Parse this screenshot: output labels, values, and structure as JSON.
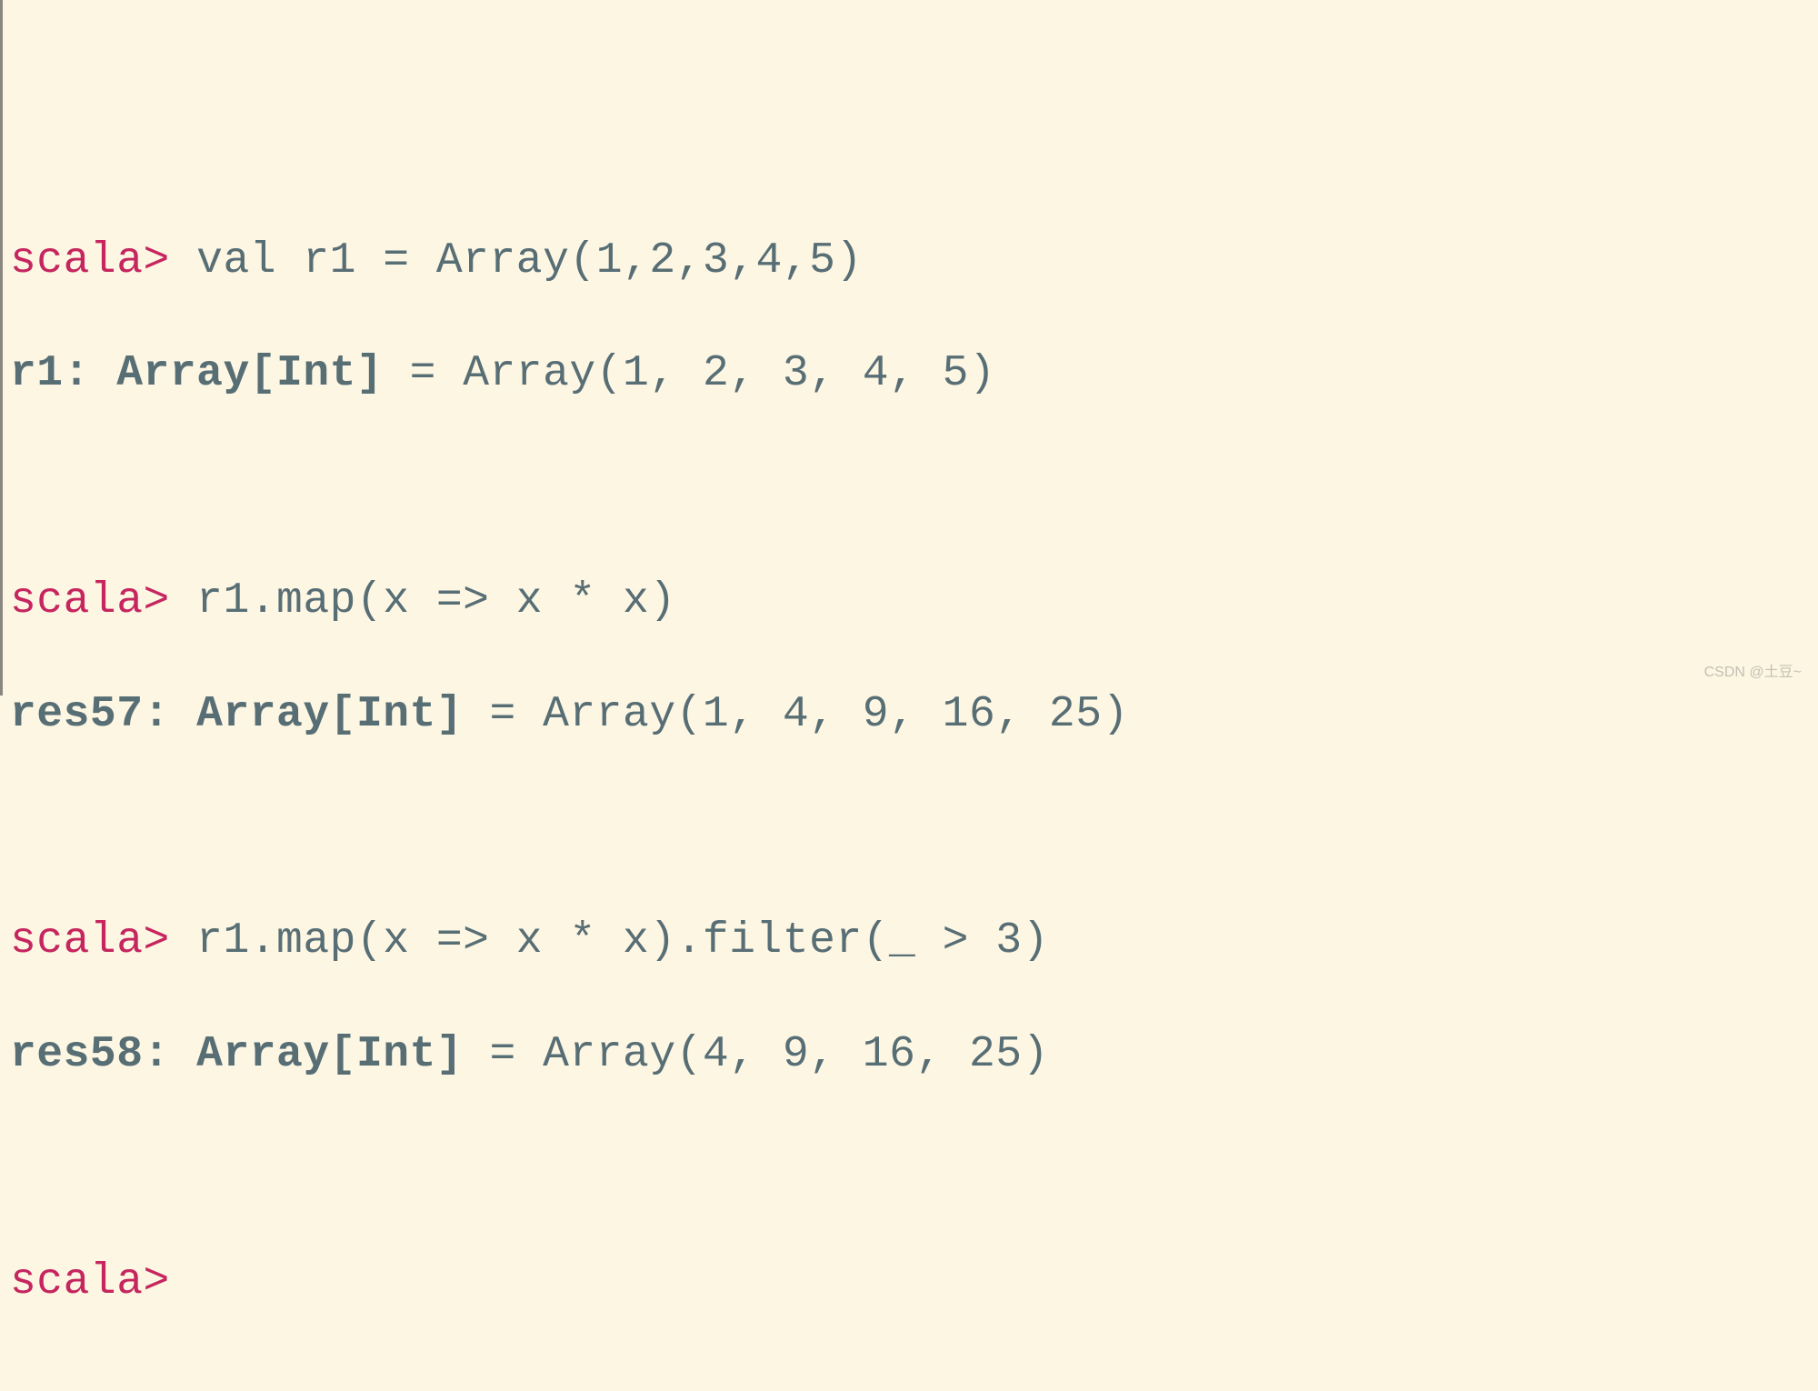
{
  "entries": [
    {
      "prompt": "scala>",
      "input": " val r1 = Array(1,2,3,4,5)",
      "res_label": "r1:",
      "res_type": " Array[Int]",
      "res_value": " = Array(1, 2, 3, 4, 5)"
    },
    {
      "prompt": "scala>",
      "input": " r1.map(x => x * x)",
      "res_label": "res57:",
      "res_type": " Array[Int]",
      "res_value": " = Array(1, 4, 9, 16, 25)"
    },
    {
      "prompt": "scala>",
      "input": " r1.map(x => x * x).filter(_ > 3)",
      "res_label": "res58:",
      "res_type": " Array[Int]",
      "res_value": " = Array(4, 9, 16, 25)"
    }
  ],
  "final_prompt": "scala>",
  "watermark": "CSDN @土豆~"
}
